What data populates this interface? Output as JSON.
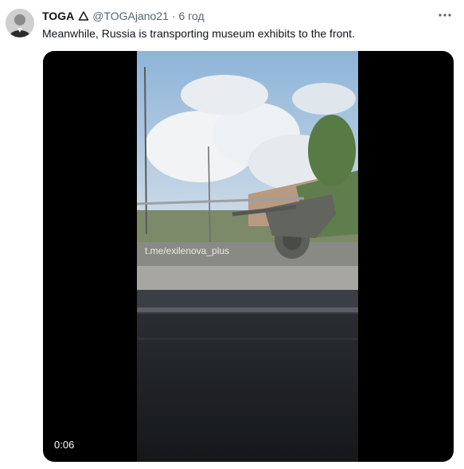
{
  "tweet": {
    "display_name": "TOGA",
    "handle": "@TOGAjano21",
    "separator": "·",
    "timestamp": "6 год",
    "text": "Meanwhile, Russia is transporting museum exhibits to the front.",
    "badge_icon": "triangle-icon",
    "more_icon": "more-dots-icon"
  },
  "media": {
    "type": "video",
    "duration": "0:06",
    "watermark": "t.me/exilenova_plus"
  },
  "colors": {
    "text": "#0f1419",
    "secondary": "#536471",
    "media_background": "#000000"
  }
}
